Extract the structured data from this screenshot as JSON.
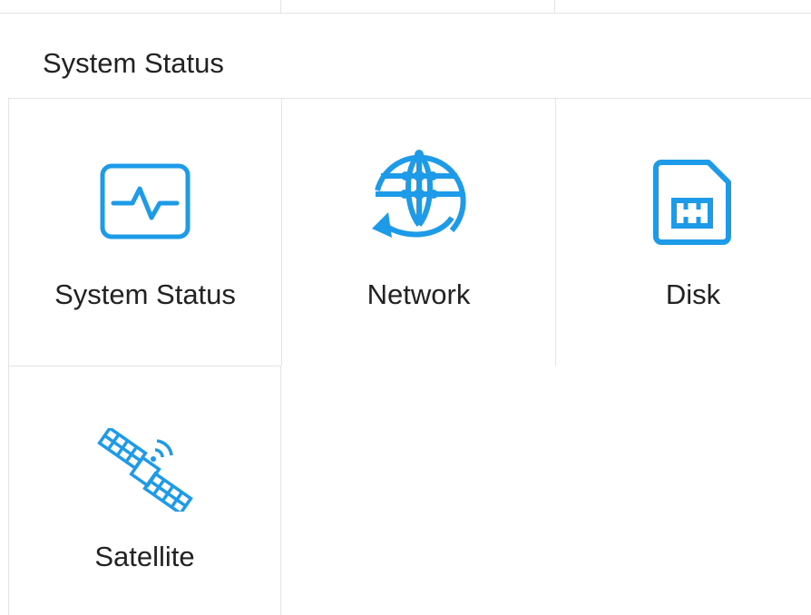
{
  "section": {
    "title": "System Status"
  },
  "tiles": [
    {
      "label": "System Status",
      "icon": "activity-monitor-icon"
    },
    {
      "label": "Network",
      "icon": "network-globe-icon"
    },
    {
      "label": "Disk",
      "icon": "sd-card-icon"
    },
    {
      "label": "Satellite",
      "icon": "satellite-icon"
    }
  ],
  "colors": {
    "accent": "#1e9be8",
    "border": "#e4e4e4",
    "text": "#222222"
  }
}
